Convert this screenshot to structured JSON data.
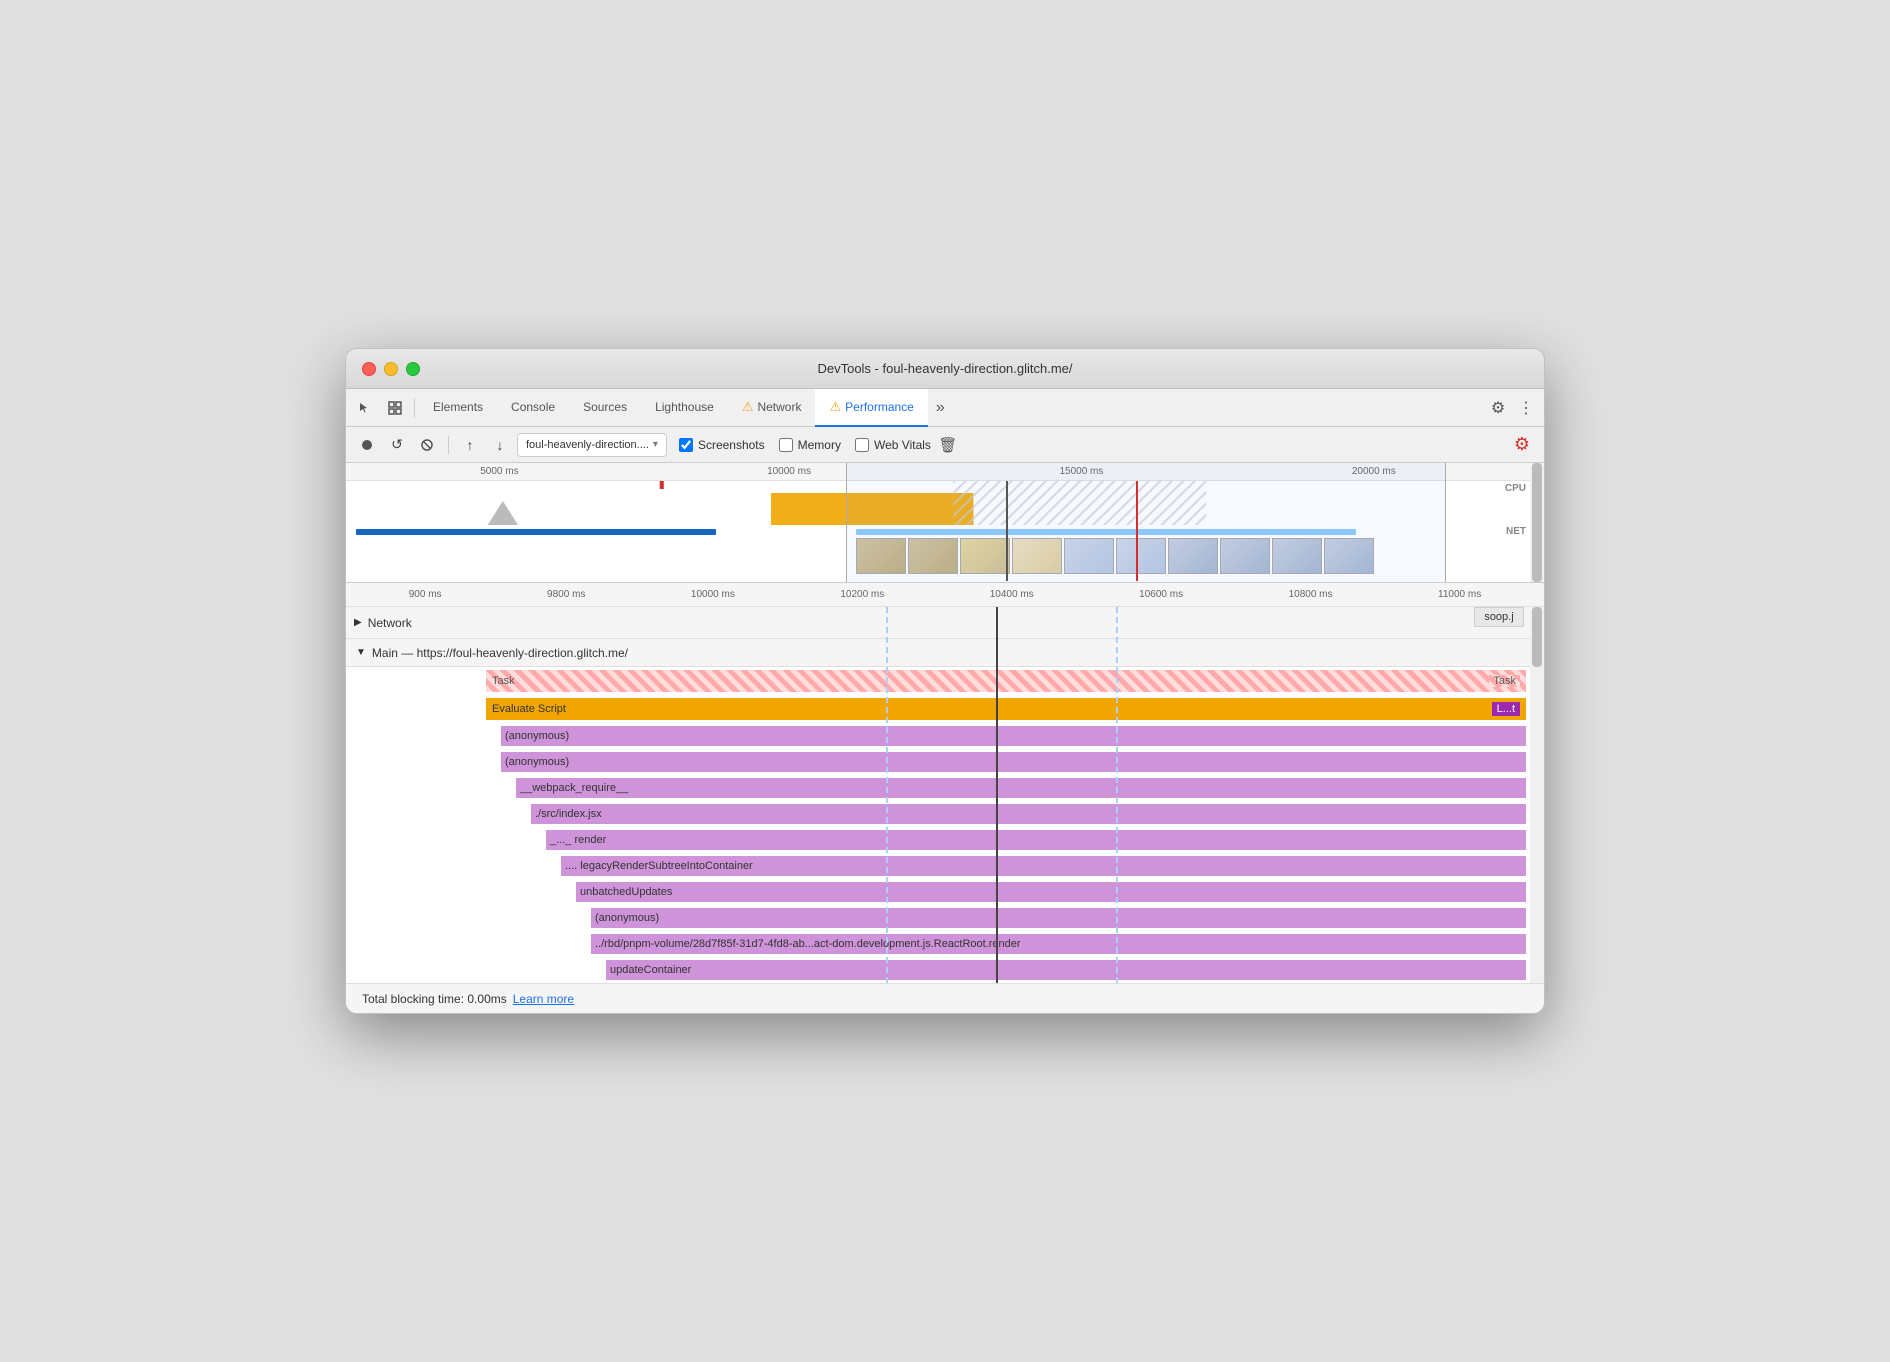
{
  "window": {
    "title": "DevTools - foul-heavenly-direction.glitch.me/"
  },
  "tabs": {
    "items": [
      {
        "label": "Elements",
        "active": false
      },
      {
        "label": "Console",
        "active": false
      },
      {
        "label": "Sources",
        "active": false
      },
      {
        "label": "Lighthouse",
        "active": false,
        "warning": false
      },
      {
        "label": "Network",
        "active": false,
        "warning": true
      },
      {
        "label": "Performance",
        "active": true,
        "warning": true
      },
      {
        "label": "»",
        "active": false
      }
    ]
  },
  "toolbar": {
    "url": "foul-heavenly-direction....",
    "screenshots_label": "Screenshots",
    "memory_label": "Memory",
    "web_vitals_label": "Web Vitals"
  },
  "overview": {
    "time_marks": [
      "5000 ms",
      "10000 ms",
      "15000 ms",
      "20000 ms"
    ],
    "cpu_label": "CPU",
    "net_label": "NET"
  },
  "zoom": {
    "time_marks": [
      "900 ms",
      "9800 ms",
      "10000 ms",
      "10200 ms",
      "10400 ms",
      "10600 ms",
      "10800 ms",
      "11000 ms"
    ]
  },
  "network_section": {
    "label": "Network",
    "file": "soop.j"
  },
  "main_section": {
    "title": "Main — https://foul-heavenly-direction.glitch.me/",
    "rows": [
      {
        "label": "Task",
        "type": "task"
      },
      {
        "label": "Evaluate Script",
        "type": "evaluate"
      },
      {
        "label": "(anonymous)",
        "type": "purple",
        "indent": 1
      },
      {
        "label": "(anonymous)",
        "type": "purple",
        "indent": 1
      },
      {
        "label": "__webpack_require__",
        "type": "purple",
        "indent": 2
      },
      {
        "label": "./src/index.jsx",
        "type": "purple",
        "indent": 3
      },
      {
        "label": "_..._ render",
        "type": "purple",
        "indent": 4
      },
      {
        "label": ".... legacyRenderSubtreeIntoContainer",
        "type": "purple",
        "indent": 5
      },
      {
        "label": "unbatchedUpdates",
        "type": "purple",
        "indent": 6
      },
      {
        "label": "(anonymous)",
        "type": "purple",
        "indent": 7
      },
      {
        "label": "../rbd/pnpm-volume/28d7f85f-31d7-4fd8-ab...act-dom.development.js.ReactRoot.render",
        "type": "purple",
        "indent": 7
      },
      {
        "label": "updateContainer",
        "type": "purple",
        "indent": 8
      },
      {
        "label": "...",
        "type": "purple",
        "indent": 9
      }
    ]
  },
  "status_bar": {
    "text": "Total blocking time: 0.00ms",
    "learn_more": "Learn more"
  }
}
